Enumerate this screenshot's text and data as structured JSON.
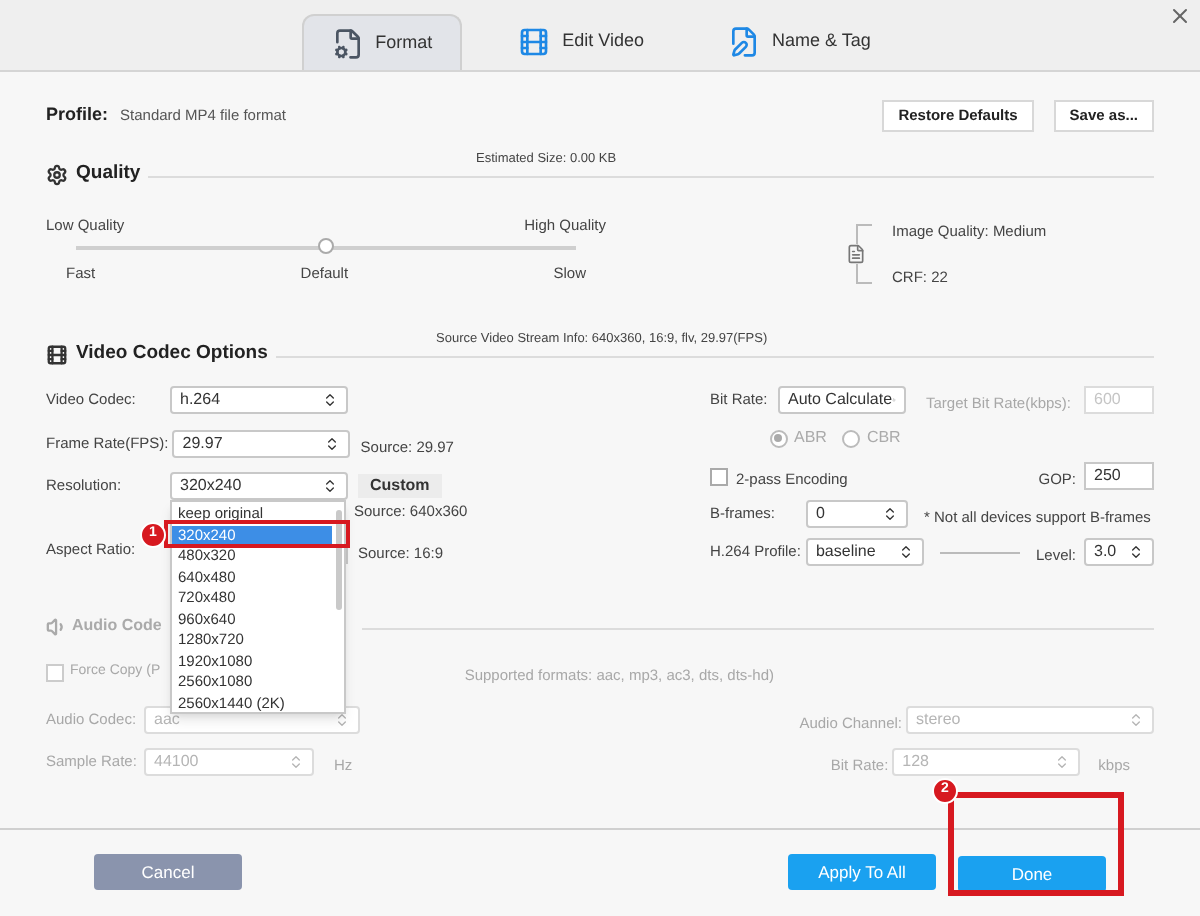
{
  "tabs": [
    {
      "label": "Format",
      "kind": "format",
      "selected": true
    },
    {
      "label": "Edit Video",
      "kind": "edit",
      "selected": false
    },
    {
      "label": "Name & Tag",
      "kind": "tag",
      "selected": false
    }
  ],
  "profile": {
    "label": "Profile:",
    "value": "Standard MP4 file format"
  },
  "profile_buttons": [
    "Restore Defaults",
    "Save as..."
  ],
  "quality": {
    "title": "Quality",
    "estimated_size": "Estimated Size: 0.00 KB",
    "low_label": "Low Quality",
    "high_label": "High Quality",
    "speed_labels": [
      "Fast",
      "Default",
      "Slow"
    ],
    "level": 0.5,
    "image_quality": "Image Quality: Medium",
    "crf": "CRF: 22"
  },
  "video_codec": {
    "title": "Video Codec Options",
    "source_info": "Source Video Stream Info: 640x360, 16:9, flv, 29.97(FPS)",
    "codec": {
      "label": "Video Codec:",
      "value": "h.264"
    },
    "frame_rate": {
      "label": "Frame Rate(FPS):",
      "value": "29.97",
      "source": "Source: 29.97"
    },
    "resolution": {
      "label": "Resolution:",
      "value": "320x240",
      "custom_button": "Custom",
      "source": "Source: 640x360",
      "expanded": true,
      "options": [
        {
          "label": "keep original",
          "selected": false
        },
        {
          "label": "320x240",
          "selected": true
        },
        {
          "label": "480x320",
          "selected": false
        },
        {
          "label": "640x480",
          "selected": false
        },
        {
          "label": "720x480",
          "selected": false
        },
        {
          "label": "960x640",
          "selected": false
        },
        {
          "label": "1280x720",
          "selected": false
        },
        {
          "label": "1920x1080",
          "selected": false
        },
        {
          "label": "2560x1080",
          "selected": false
        },
        {
          "label": "2560x1440 (2K)",
          "selected": false
        }
      ]
    },
    "aspect_ratio": {
      "label": "Aspect Ratio:",
      "source": "Source: 16:9"
    },
    "bit_rate": {
      "label": "Bit Rate:",
      "value": "Auto Calculate"
    },
    "target_bit_rate": {
      "label": "Target Bit Rate(kbps):",
      "value": "600",
      "disabled": true
    },
    "rate_modes": [
      {
        "label": "ABR",
        "selected": true
      },
      {
        "label": "CBR",
        "selected": false
      }
    ],
    "two_pass": {
      "label": "2-pass Encoding",
      "checked": false
    },
    "gop": {
      "label": "GOP:",
      "value": "250"
    },
    "b_frames": {
      "label": "B-frames:",
      "value": "0",
      "note": "* Not all devices support B-frames"
    },
    "h264_profile": {
      "label": "H.264 Profile:",
      "value": "baseline"
    },
    "profile_level": {
      "label": "Level:",
      "value": "3.0"
    }
  },
  "audio": {
    "title": "Audio Code",
    "disabled": true,
    "force_copy": {
      "label": "Force Copy (P",
      "checked": false
    },
    "supported_formats": "Supported formats: aac, mp3, ac3, dts, dts-hd)",
    "codec": {
      "label": "Audio Codec:",
      "value": "aac"
    },
    "channel": {
      "label": "Audio Channel:",
      "value": "stereo"
    },
    "sample_rate": {
      "label": "Sample Rate:",
      "value": "44100",
      "unit": "Hz"
    },
    "bit_rate": {
      "label": "Bit Rate:",
      "value": "128",
      "unit": "kbps"
    }
  },
  "footer": {
    "cancel": "Cancel",
    "apply_all": "Apply To All",
    "done": "Done"
  },
  "annotations": [
    {
      "number": "1"
    },
    {
      "number": "2"
    }
  ]
}
